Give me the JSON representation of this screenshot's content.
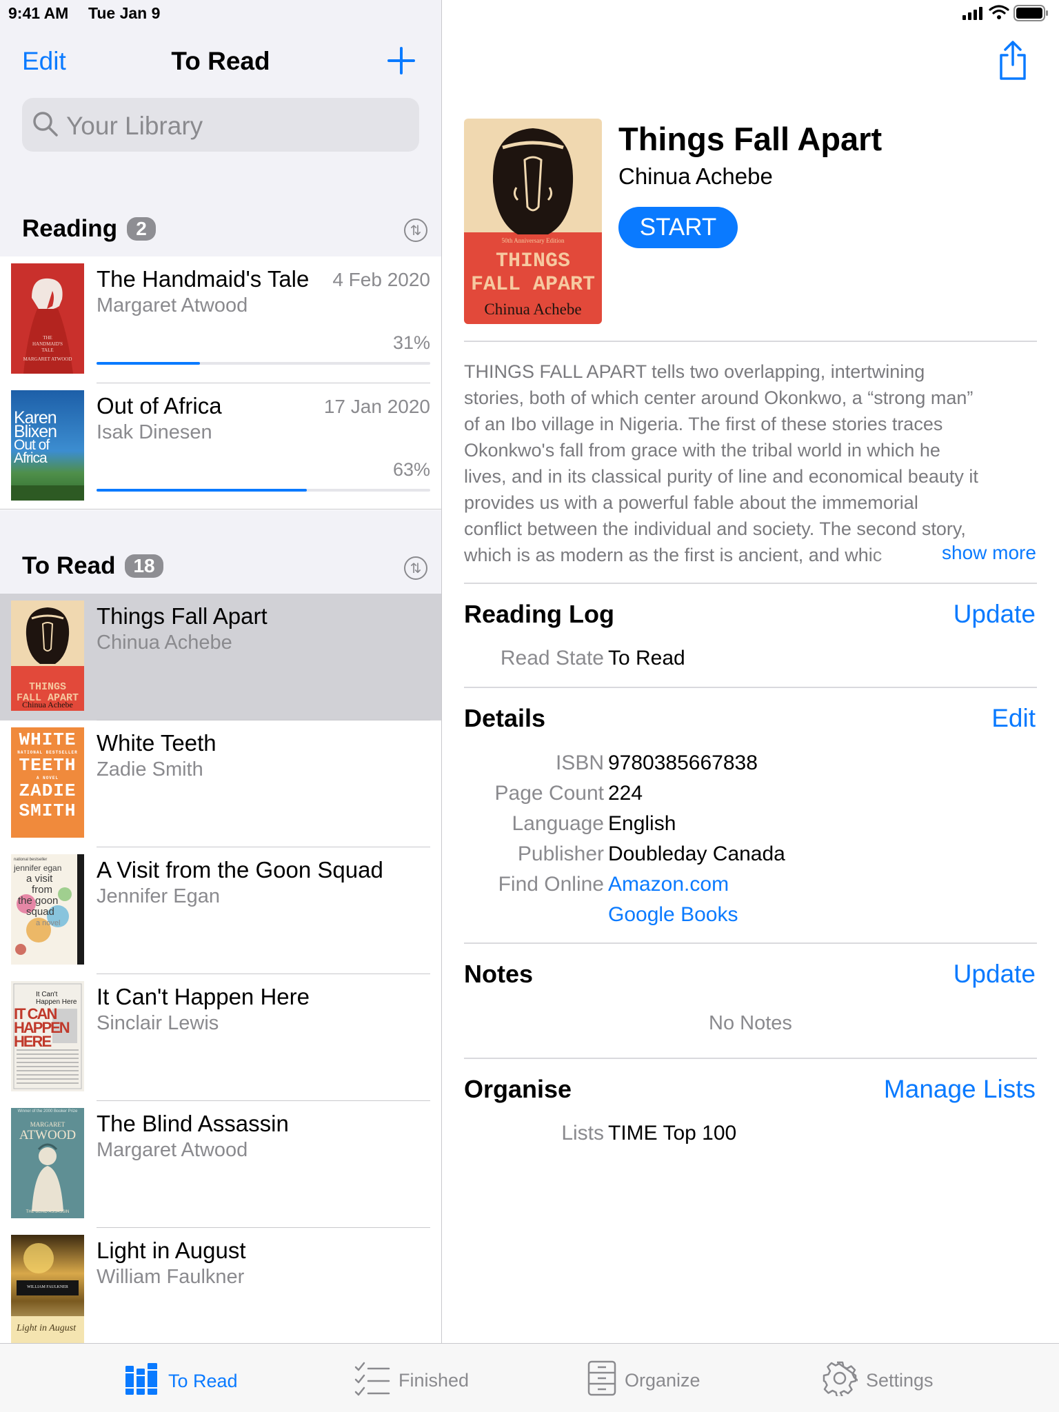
{
  "status_bar": {
    "time": "9:41 AM",
    "date": "Tue Jan 9"
  },
  "nav": {
    "edit_label": "Edit",
    "title": "To Read",
    "add_icon": "plus-icon"
  },
  "search": {
    "placeholder": "Your Library"
  },
  "reading_section": {
    "title": "Reading",
    "count": "2",
    "items": [
      {
        "title": "The Handmaid's Tale",
        "author": "Margaret Atwood",
        "date": "4 Feb 2020",
        "progress_label": "31%",
        "progress": 0.31
      },
      {
        "title": "Out of Africa",
        "author": "Isak Dinesen",
        "date": "17 Jan 2020",
        "progress_label": "63%",
        "progress": 0.63
      }
    ]
  },
  "to_read_section": {
    "title": "To Read",
    "count": "18",
    "items": [
      {
        "title": "Things Fall Apart",
        "author": "Chinua Achebe",
        "selected": true
      },
      {
        "title": "White Teeth",
        "author": "Zadie Smith"
      },
      {
        "title": "A Visit from the Goon Squad",
        "author": "Jennifer Egan"
      },
      {
        "title": "It Can't Happen Here",
        "author": "Sinclair Lewis"
      },
      {
        "title": "The Blind Assassin",
        "author": "Margaret Atwood"
      },
      {
        "title": "Light in August",
        "author": "William Faulkner"
      }
    ]
  },
  "covers": {
    "handmaid": {
      "line1": "THE",
      "line2": "HANDMAID'S",
      "line3": "TALE",
      "line4": "MARGARET ATWOOD"
    },
    "africa": {
      "line1": "Karen",
      "line2": "Blixen",
      "line3": "Out of",
      "line4": "Africa"
    },
    "things": {
      "edition": "50th Anniversary Edition",
      "line1": "THINGS",
      "line2": "FALL APART",
      "author": "Chinua Achebe"
    },
    "white": {
      "line1": "WHITE",
      "line2": "TEETH",
      "line3": "ZADIE",
      "line4": "SMITH",
      "sub1": "NATIONAL BESTSELLER",
      "sub2": "A NOVEL"
    },
    "goon": {
      "l0": "national bestseller",
      "l1": "jennifer egan",
      "l2": "a visit",
      "l3": "from",
      "l4": "the goon",
      "l5": "squad",
      "l6": "a novel"
    },
    "happen": {
      "l1": "It Can't",
      "l2": "Happen Here",
      "l3": "IT CAN",
      "l4": "HAPPEN",
      "l5": "HERE"
    },
    "blind": {
      "l0": "Winner of the 2000 Booker Prize",
      "l1": "MARGARET",
      "l2": "ATWOOD",
      "l3": "THE BLIND ASSASSIN"
    },
    "august": {
      "l1": "WILLIAM FAULKNER",
      "l2": "Light in August"
    }
  },
  "detail": {
    "share_icon": "share-icon",
    "title": "Things Fall Apart",
    "author": "Chinua Achebe",
    "start_label": "START",
    "description_lines": [
      "THINGS FALL APART tells two overlapping, intertwining",
      "stories, both of which center around Okonkwo, a “strong man”",
      "of an Ibo village in Nigeria. The first of these stories traces",
      "Okonkwo's fall from grace with the tribal world in which he",
      "lives, and in its classical purity of line and economical beauty it",
      "provides us with a powerful fable about the immemorial",
      "conflict between the individual and society. The second story,",
      "which is as modern as the first is ancient, and whic"
    ],
    "show_more": "show more",
    "reading_log": {
      "title": "Reading Log",
      "action": "Update",
      "read_state_label": "Read State",
      "read_state_value": "To Read"
    },
    "details": {
      "title": "Details",
      "action": "Edit",
      "isbn_label": "ISBN",
      "isbn": "9780385667838",
      "page_count_label": "Page Count",
      "page_count": "224",
      "language_label": "Language",
      "language": "English",
      "publisher_label": "Publisher",
      "publisher": "Doubleday Canada",
      "find_online_label": "Find Online",
      "amazon": "Amazon.com",
      "google": "Google Books"
    },
    "notes": {
      "title": "Notes",
      "action": "Update",
      "empty": "No Notes"
    },
    "organise": {
      "title": "Organise",
      "action": "Manage Lists",
      "lists_label": "Lists",
      "lists_value": "TIME Top 100"
    }
  },
  "tabbar": {
    "to_read": "To Read",
    "finished": "Finished",
    "organize": "Organize",
    "settings": "Settings"
  },
  "colors": {
    "accent": "#0a7aff",
    "selected_row": "#d1d1d6",
    "grouped_bg": "#f2f2f7"
  }
}
